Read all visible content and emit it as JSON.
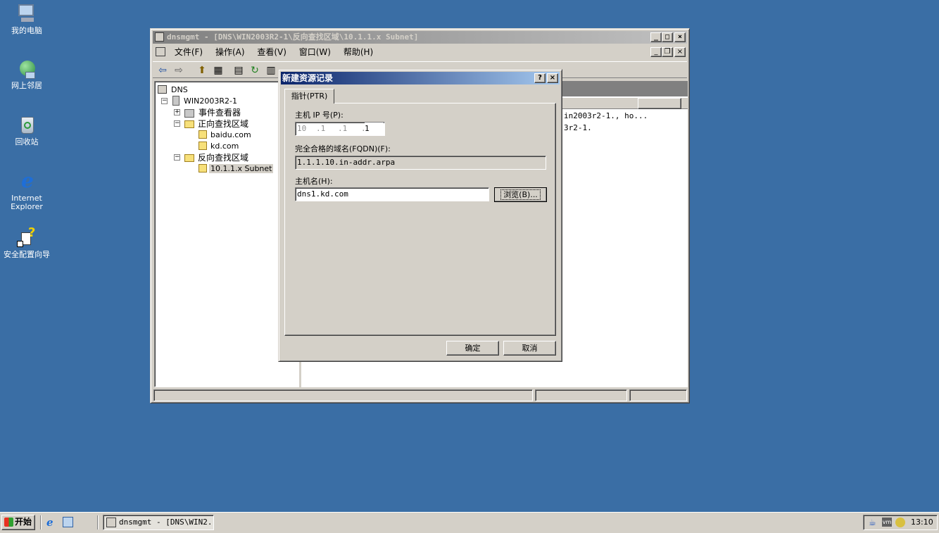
{
  "desktop": {
    "icons": [
      {
        "label": "我的电脑"
      },
      {
        "label": "网上邻居"
      },
      {
        "label": "回收站"
      },
      {
        "label": "Internet Explorer"
      },
      {
        "label": "安全配置向导"
      }
    ]
  },
  "window": {
    "title": "dnsmgmt - [DNS\\WIN2003R2-1\\反向查找区域\\10.1.1.x Subnet]",
    "menu": [
      "文件(F)",
      "操作(A)",
      "查看(V)",
      "窗口(W)",
      "帮助(H)"
    ],
    "tree": {
      "root": "DNS",
      "server": "WIN2003R2-1",
      "event_viewer": "事件查看器",
      "forward_zones": "正向查找区域",
      "zone1": "baidu.com",
      "zone2": "kd.com",
      "reverse_zones": "反向查找区域",
      "subnet": "10.1.1.x Subnet"
    },
    "list_rows": [
      "in2003r2-1., ho...",
      "3r2-1."
    ]
  },
  "dialog": {
    "title": "新建资源记录",
    "help_label": "?",
    "close_label": "×",
    "tab": "指针(PTR)",
    "ip_label": "主机 IP 号(P):",
    "ip_octets": [
      "10",
      ".1",
      ".1",
      ".",
      "1"
    ],
    "fqdn_label": "完全合格的域名(FQDN)(F):",
    "fqdn_value": "1.1.1.10.in-addr.arpa",
    "host_label": "主机名(H):",
    "host_value": "dns1.kd.com",
    "browse_label": "浏览(B)...",
    "ok_label": "确定",
    "cancel_label": "取消"
  },
  "taskbar": {
    "start_label": "开始",
    "task_label": "dnsmgmt - [DNS\\WIN2...",
    "clock": "13:10"
  }
}
